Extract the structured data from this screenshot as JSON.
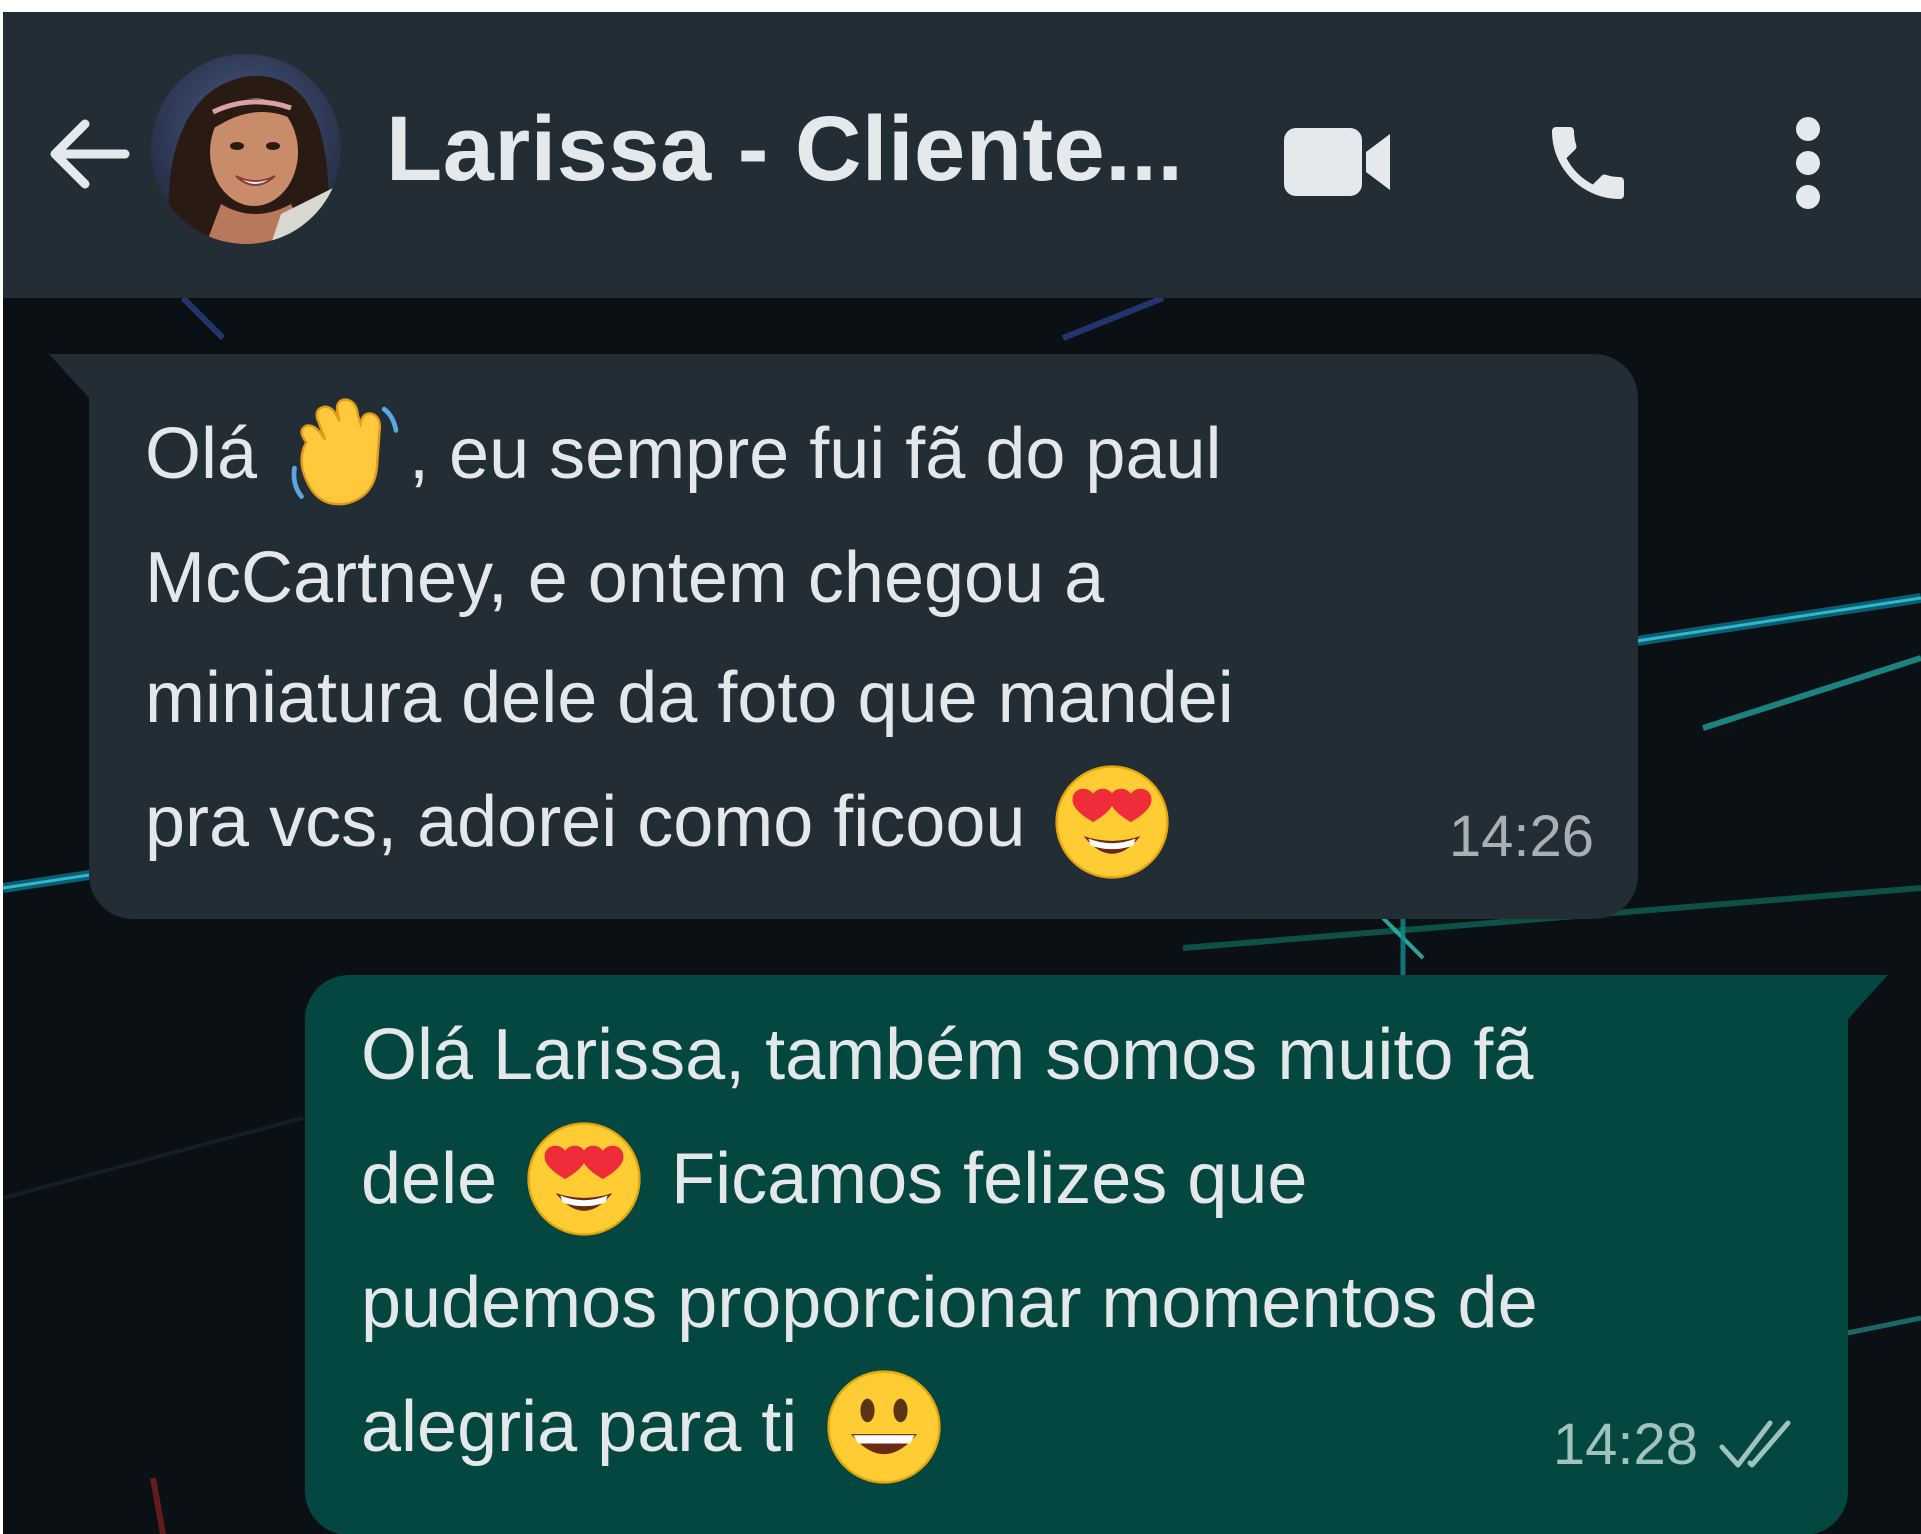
{
  "header": {
    "contact_name": "Larissa - Cliente...",
    "back_icon": "arrow-left-icon",
    "video_icon": "video-camera-icon",
    "call_icon": "phone-icon",
    "menu_icon": "more-vertical-icon",
    "background_color": "#232d36"
  },
  "messages": [
    {
      "direction": "incoming",
      "lines": [
        {
          "a": "Olá",
          "emoji": "waving-hand",
          "b": ",  eu sempre fui fã do paul"
        },
        {
          "a": "McCartney, e ontem chegou a"
        },
        {
          "a": "miniatura dele da foto que mandei"
        },
        {
          "a": "pra vcs, adorei como ficoou",
          "emoji": "heart-eyes"
        }
      ],
      "time": "14:26",
      "bubble_color": "#232d36"
    },
    {
      "direction": "outgoing",
      "lines": [
        {
          "a": "Olá Larissa, também somos muito fã"
        },
        {
          "a": "dele",
          "emoji": "heart-eyes",
          "b": "Ficamos felizes que"
        },
        {
          "a": "pudemos proporcionar momentos de"
        },
        {
          "a": "alegria para ti",
          "emoji": "grinning-face"
        }
      ],
      "time": "14:28",
      "status_icon": "double-check-icon",
      "bubble_color": "#044740"
    }
  ],
  "colors": {
    "chat_background": "#0b1014",
    "text": "#e5e8ea",
    "meta_text": "#a7b0b6"
  }
}
